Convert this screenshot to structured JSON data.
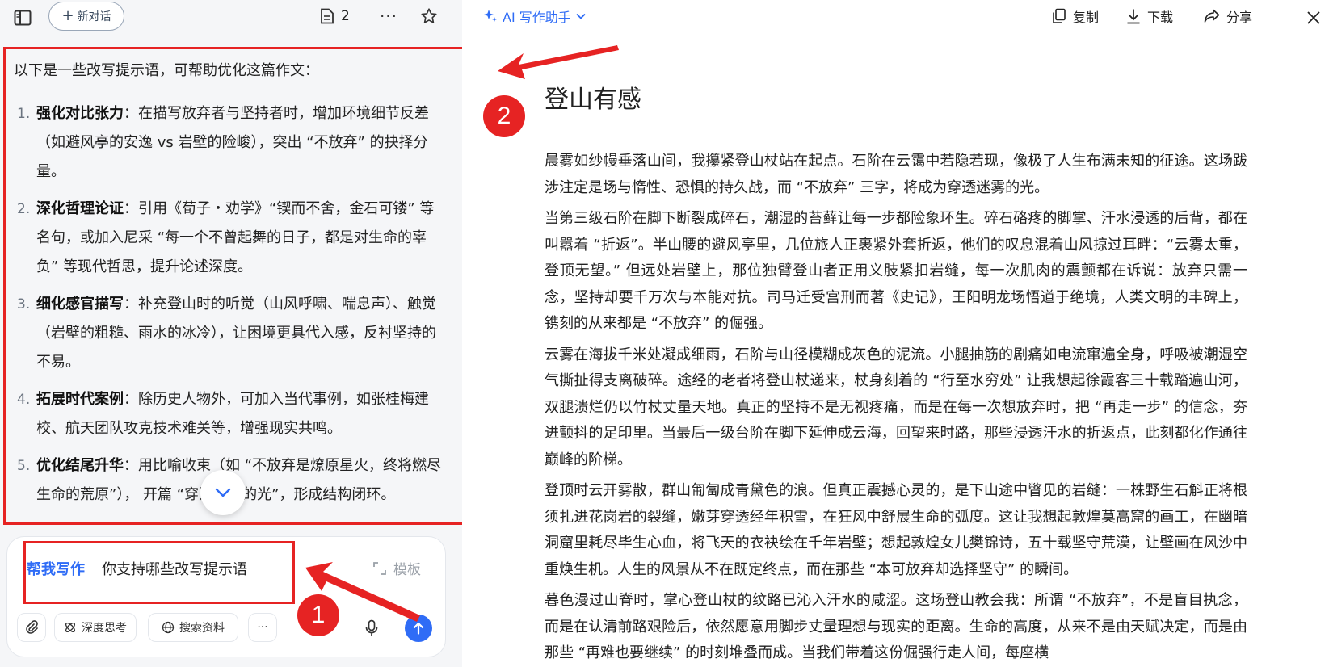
{
  "left_panel": {
    "new_chat_label": "新对话",
    "doc_count": "2",
    "intro": "以下是一些改写提示语，可帮助优化这篇作文：",
    "tips": [
      {
        "num": "1.",
        "title": "强化对比张力",
        "text": "：在描写放弃者与坚持者时，增加环境细节反差（如避风亭的安逸 vs 岩壁的险峻），突出 “不放弃” 的抉择分量。"
      },
      {
        "num": "2.",
        "title": "深化哲理论证",
        "text": "：引用《荀子・劝学》“锲而不舍，金石可镂” 等名句，或加入尼采 “每一个不曾起舞的日子，都是对生命的辜负” 等现代哲思，提升论述深度。"
      },
      {
        "num": "3.",
        "title": "细化感官描写",
        "text": "：补充登山时的听觉（山风呼啸、喘息声）、触觉（岩壁的粗糙、雨水的冰冷），让困境更具代入感，反衬坚持的不易。"
      },
      {
        "num": "4.",
        "title": "拓展时代案例",
        "text": "：除历史人物外，可加入当代事例，如张桂梅建校、航天团队攻克技术难关等，增强现实共鸣。"
      },
      {
        "num": "5.",
        "title": "优化结尾升华",
        "text": "：用比喻收束（如 “不放弃是燎原星火，终将燃尽生命的荒原”），      开篇 “穿透迷雾的光”，形成结构闭环。"
      }
    ],
    "composer": {
      "mode_label": "帮我写作",
      "query": "你支持哪些改写提示语",
      "template_label": "模板",
      "deep_think_label": "深度思考",
      "search_label": "搜索资料",
      "more_label": "···"
    }
  },
  "annotations": {
    "badge1": "1",
    "badge2": "2",
    "color": "#e62323"
  },
  "right_panel": {
    "assistant_label": "AI 写作助手",
    "copy_label": "复制",
    "download_label": "下载",
    "share_label": "分享",
    "doc_title": "登山有感",
    "paragraphs": [
      "晨雾如纱幔垂落山间，我攥紧登山杖站在起点。石阶在云霭中若隐若现，像极了人生布满未知的征途。这场跋涉注定是场与惰性、恐惧的持久战，而 “不放弃” 三字，将成为穿透迷雾的光。",
      "当第三级石阶在脚下断裂成碎石，潮湿的苔藓让每一步都险象环生。碎石硌疼的脚掌、汗水浸透的后背，都在叫嚣着 “折返”。半山腰的避风亭里，几位旅人正裹紧外套折返，他们的叹息混着山风掠过耳畔：“云雾太重，登顶无望。” 但远处岩壁上，那位独臂登山者正用义肢紧扣岩缝，每一次肌肉的震颤都在诉说：放弃只需一念，坚持却要千万次与本能对抗。司马迁受宫刑而著《史记》，王阳明龙场悟道于绝境，人类文明的丰碑上，镌刻的从来都是 “不放弃” 的倔强。",
      "云雾在海拔千米处凝成细雨，石阶与山径模糊成灰色的泥流。小腿抽筋的剧痛如电流窜遍全身，呼吸被潮湿空气撕扯得支离破碎。途经的老者将登山杖递来，杖身刻着的 “行至水穷处” 让我想起徐霞客三十载踏遍山河，双腿溃烂仍以竹杖丈量天地。真正的坚持不是无视疼痛，而是在每一次想放弃时，把 “再走一步” 的信念，夯进颤抖的足印里。当最后一级台阶在脚下延伸成云海，回望来时路，那些浸透汗水的折返点，此刻都化作通往巅峰的阶梯。",
      "登顶时云开雾散，群山匍匐成青黛色的浪。但真正震撼心灵的，是下山途中瞥见的岩缝：一株野生石斛正将根须扎进花岗岩的裂缝，嫩芽穿透经年积雪，在狂风中舒展生命的弧度。这让我想起敦煌莫高窟的画工，在幽暗洞窟里耗尽毕生心血，将飞天的衣袂绘在千年岩壁；想起敦煌女儿樊锦诗，五十载坚守荒漠，让壁画在风沙中重焕生机。人生的风景从不在既定终点，而在那些 “本可放弃却选择坚守” 的瞬间。",
      "暮色漫过山脊时，掌心登山杖的纹路已沁入汗水的咸涩。这场登山教会我：所谓 “不放弃”，不是盲目执念，而是在认清前路艰险后，依然愿意用脚步丈量理想与现实的距离。生命的高度，从来不是由天赋决定，而是由那些 “再难也要继续” 的时刻堆叠而成。当我们带着这份倔强行走人间，每座横"
    ]
  }
}
